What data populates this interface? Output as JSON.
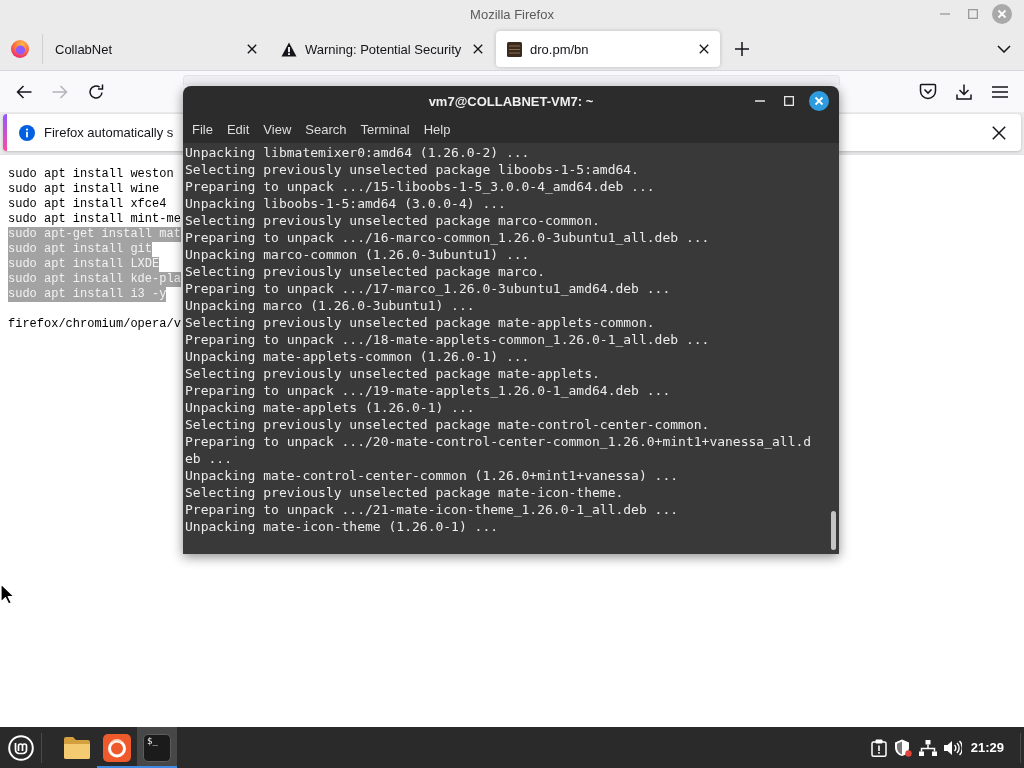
{
  "firefox": {
    "title": "Mozilla Firefox",
    "tabs": [
      {
        "kind": "plain",
        "label": "CollabNet",
        "selected": false
      },
      {
        "kind": "warning",
        "label": "Warning: Potential Security",
        "selected": false
      },
      {
        "kind": "site",
        "label": "dro.pm/bn",
        "selected": true
      }
    ],
    "nav_buttons": [
      {
        "kind": "back",
        "disabled": false
      },
      {
        "kind": "forward",
        "disabled": true
      },
      {
        "kind": "reload",
        "disabled": false
      }
    ],
    "notification": {
      "text": "Firefox automatically s"
    },
    "page": {
      "blocks": [
        {
          "lines": [
            {
              "text": "sudo apt install weston",
              "selected": false
            },
            {
              "text": "sudo apt install wine",
              "selected": false
            },
            {
              "text": "sudo apt install xfce4",
              "selected": false
            },
            {
              "text": "sudo apt install mint-me",
              "selected": false
            },
            {
              "text": "sudo apt-get install mat",
              "selected": true
            },
            {
              "text": "sudo apt install git",
              "selected": true
            },
            {
              "text": "sudo apt install LXDE",
              "selected": true
            },
            {
              "text": "sudo apt install kde-pla",
              "selected": true
            },
            {
              "text": "sudo apt install i3 -y",
              "selected": true
            }
          ]
        },
        {
          "lines": [
            {
              "text": "firefox/chromium/opera/v",
              "selected": false
            }
          ]
        }
      ]
    }
  },
  "terminal": {
    "title": "vm7@COLLABNET-VM7: ~",
    "menu": [
      "File",
      "Edit",
      "View",
      "Search",
      "Terminal",
      "Help"
    ],
    "lines": [
      "Unpacking libmatemixer0:amd64 (1.26.0-2) ...",
      "Selecting previously unselected package liboobs-1-5:amd64.",
      "Preparing to unpack .../15-liboobs-1-5_3.0.0-4_amd64.deb ...",
      "Unpacking liboobs-1-5:amd64 (3.0.0-4) ...",
      "Selecting previously unselected package marco-common.",
      "Preparing to unpack .../16-marco-common_1.26.0-3ubuntu1_all.deb ...",
      "Unpacking marco-common (1.26.0-3ubuntu1) ...",
      "Selecting previously unselected package marco.",
      "Preparing to unpack .../17-marco_1.26.0-3ubuntu1_amd64.deb ...",
      "Unpacking marco (1.26.0-3ubuntu1) ...",
      "Selecting previously unselected package mate-applets-common.",
      "Preparing to unpack .../18-mate-applets-common_1.26.0-1_all.deb ...",
      "Unpacking mate-applets-common (1.26.0-1) ...",
      "Selecting previously unselected package mate-applets.",
      "Preparing to unpack .../19-mate-applets_1.26.0-1_amd64.deb ...",
      "Unpacking mate-applets (1.26.0-1) ...",
      "Selecting previously unselected package mate-control-center-common.",
      "Preparing to unpack .../20-mate-control-center-common_1.26.0+mint1+vanessa_all.d",
      "eb ...",
      "Unpacking mate-control-center-common (1.26.0+mint1+vanessa) ...",
      "Selecting previously unselected package mate-icon-theme.",
      "Preparing to unpack .../21-mate-icon-theme_1.26.0-1_all.deb ...",
      "Unpacking mate-icon-theme (1.26.0-1) ..."
    ]
  },
  "taskbar": {
    "apps": [
      {
        "kind": "files",
        "running": false,
        "active": false
      },
      {
        "kind": "browser",
        "running": true,
        "active": false
      },
      {
        "kind": "terminal",
        "running": true,
        "active": true,
        "glyph": "$_"
      }
    ],
    "clock": "21:29"
  }
}
